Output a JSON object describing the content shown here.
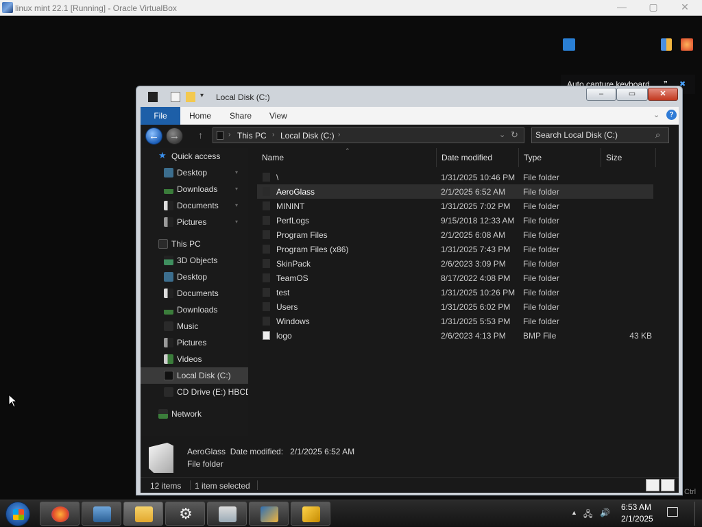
{
  "vbox": {
    "title": "linux mint 22.1 [Running] - Oracle VirtualBox",
    "min_glyph": "—",
    "max_glyph": "▢",
    "close_glyph": "✕"
  },
  "notification": {
    "text": "Auto capture keyboard ...",
    "close_glyph": "✖"
  },
  "explorer": {
    "title": "Local Disk (C:)",
    "caption": {
      "min": "–",
      "max": "▭",
      "close": "✕"
    },
    "ribbon_tabs": [
      "File",
      "Home",
      "Share",
      "View"
    ],
    "ribbon_help": "?",
    "nav": {
      "back": "←",
      "forward": "→",
      "up": "↑"
    },
    "address": {
      "crumbs": [
        "This PC",
        "Local Disk (C:)"
      ]
    },
    "search": {
      "placeholder": "Search Local Disk (C:)"
    },
    "nav_pane": {
      "quick_access": "Quick access",
      "quick_items": [
        "Desktop",
        "Downloads",
        "Documents",
        "Pictures"
      ],
      "this_pc": "This PC",
      "pc_items": [
        "3D Objects",
        "Desktop",
        "Documents",
        "Downloads",
        "Music",
        "Pictures",
        "Videos",
        "Local Disk (C:)",
        "CD Drive (E:) HBCD"
      ],
      "network": "Network"
    },
    "columns": [
      "Name",
      "Date modified",
      "Type",
      "Size"
    ],
    "files": [
      {
        "name": "\\",
        "date": "1/31/2025 10:46 PM",
        "type": "File folder",
        "size": ""
      },
      {
        "name": "AeroGlass",
        "date": "2/1/2025 6:52 AM",
        "type": "File folder",
        "size": ""
      },
      {
        "name": "MININT",
        "date": "1/31/2025 7:02 PM",
        "type": "File folder",
        "size": ""
      },
      {
        "name": "PerfLogs",
        "date": "9/15/2018 12:33 AM",
        "type": "File folder",
        "size": ""
      },
      {
        "name": "Program Files",
        "date": "2/1/2025 6:08 AM",
        "type": "File folder",
        "size": ""
      },
      {
        "name": "Program Files (x86)",
        "date": "1/31/2025 7:43 PM",
        "type": "File folder",
        "size": ""
      },
      {
        "name": "SkinPack",
        "date": "2/6/2023 3:09 PM",
        "type": "File folder",
        "size": ""
      },
      {
        "name": "TeamOS",
        "date": "8/17/2022 4:08 PM",
        "type": "File folder",
        "size": ""
      },
      {
        "name": "test",
        "date": "1/31/2025 10:26 PM",
        "type": "File folder",
        "size": ""
      },
      {
        "name": "Users",
        "date": "1/31/2025 6:02 PM",
        "type": "File folder",
        "size": ""
      },
      {
        "name": "Windows",
        "date": "1/31/2025 5:53 PM",
        "type": "File folder",
        "size": ""
      },
      {
        "name": "logo",
        "date": "2/6/2023 4:13 PM",
        "type": "BMP File",
        "size": "43 KB"
      }
    ],
    "details": {
      "name_line": "AeroGlass  Date modified:   2/1/2025 6:52 AM",
      "type_line": "File folder"
    },
    "status": {
      "count": "12 items",
      "selected": "1 item selected"
    }
  },
  "taskbar": {
    "apps": [
      "firefox",
      "remote-desktop",
      "file-explorer",
      "settings",
      "notepad",
      "virtualbox",
      "x64-tool"
    ],
    "clock_time": "6:53 AM",
    "clock_date": "2/1/2025",
    "tray_arrow": "▲"
  },
  "ctrl_hint": "Ctrl",
  "colors": {
    "accent": "#1d5fa8",
    "file_tab": "#1d5fa8",
    "folder": "#2b2b2b"
  }
}
